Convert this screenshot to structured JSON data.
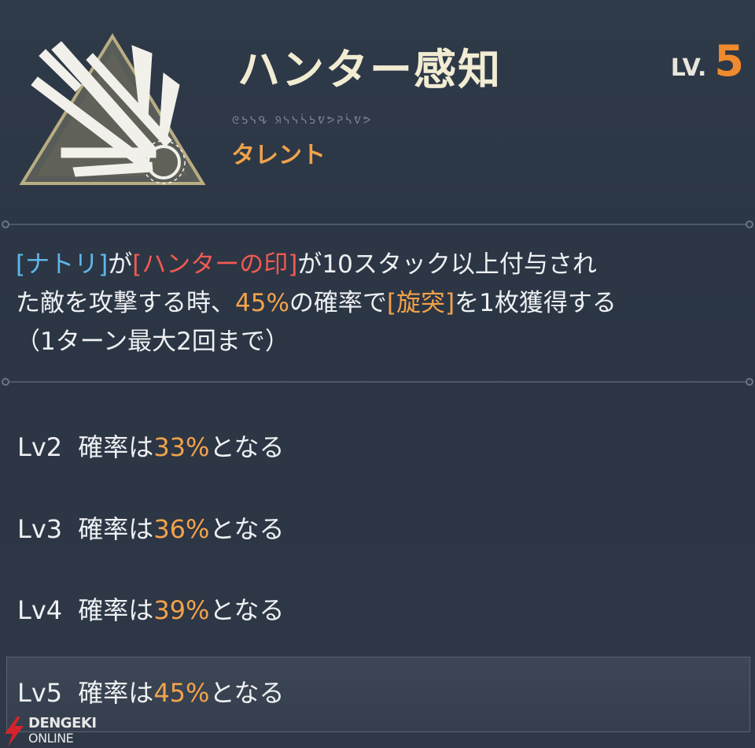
{
  "skill": {
    "name": "ハンター感知",
    "level_prefix": "LV.",
    "level_value": "5",
    "rune_text": "ᘓᕊᓭᕴ ᖆᓭᓭᓵᕊᕓᕗᕈᓵᕓᕗ",
    "category": "タレント",
    "icon": "hunter-sense-arrows-icon"
  },
  "description": {
    "line1": [
      {
        "text": "[ナトリ]",
        "color": "blue"
      },
      {
        "text": "が",
        "color": "white"
      },
      {
        "text": "[ハンターの印]",
        "color": "red"
      },
      {
        "text": "が10スタック以上付与され",
        "color": "white"
      }
    ],
    "line2": [
      {
        "text": "た敵を攻撃する時、",
        "color": "white"
      },
      {
        "text": "45%",
        "color": "orange"
      },
      {
        "text": "の確率で",
        "color": "white"
      },
      {
        "text": "[旋突]",
        "color": "orange"
      },
      {
        "text": "を1枚獲得する",
        "color": "white"
      }
    ],
    "line3": [
      {
        "text": "（1ターン最大2回まで）",
        "color": "white"
      }
    ]
  },
  "level_list": [
    {
      "label": "Lv2",
      "prefix": "確率は",
      "value": "33%",
      "suffix": "となる"
    },
    {
      "label": "Lv3",
      "prefix": "確率は",
      "value": "36%",
      "suffix": "となる"
    },
    {
      "label": "Lv4",
      "prefix": "確率は",
      "value": "39%",
      "suffix": "となる"
    },
    {
      "label": "Lv5",
      "prefix": "確率は",
      "value": "45%",
      "suffix": "となる"
    }
  ],
  "watermark": {
    "line1": "DENGEKI",
    "line2": "ONLINE"
  },
  "colors": {
    "accent_orange": "#f08a2c",
    "highlight_orange": "#f2a24b",
    "keyword_blue": "#5fb8ec",
    "keyword_red": "#f05a52",
    "title_cream": "#f1ecd2"
  }
}
